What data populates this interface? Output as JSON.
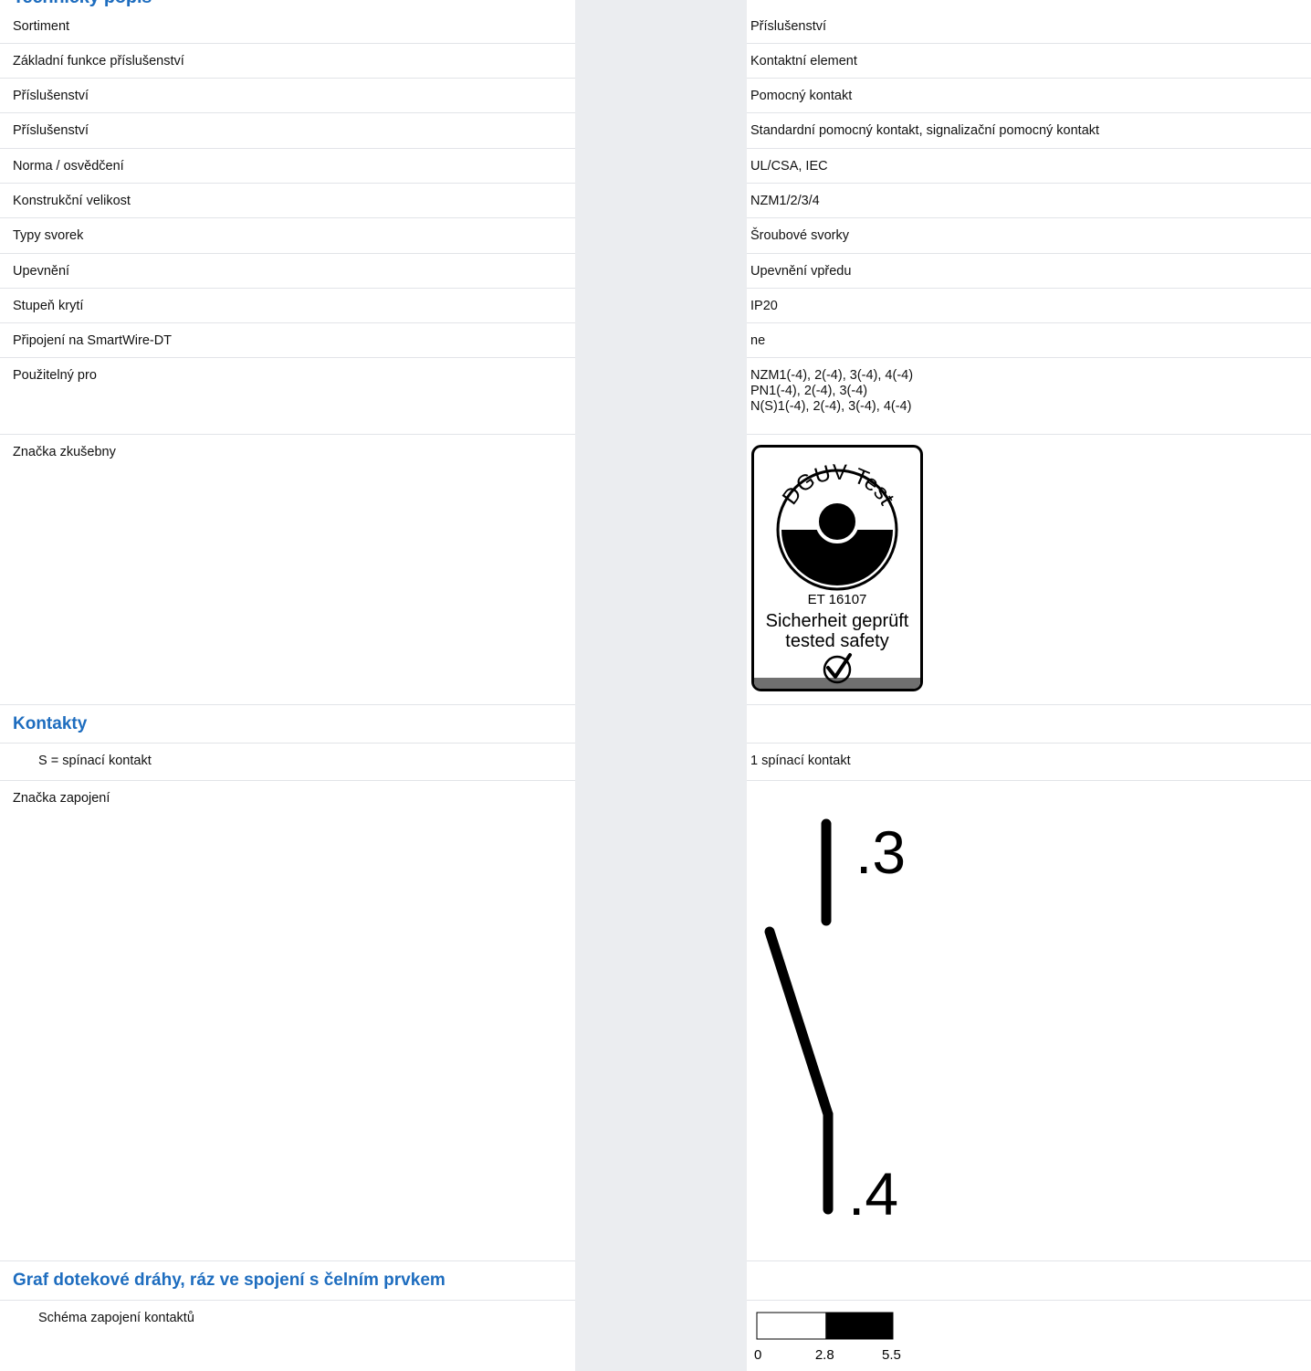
{
  "header": {
    "title": "Technický popis"
  },
  "properties": [
    {
      "label": "Sortiment",
      "value": "Příslušenství"
    },
    {
      "label": "Základní funkce příslušenství",
      "value": "Kontaktní element"
    },
    {
      "label": "Příslušenství",
      "value": "Pomocný kontakt"
    },
    {
      "label": "Příslušenství",
      "value": "Standardní pomocný kontakt, signalizační pomocný kontakt"
    },
    {
      "label": "Norma / osvědčení",
      "value": "UL/CSA, IEC"
    },
    {
      "label": "Konstrukční velikost",
      "value": "NZM1/2/3/4"
    },
    {
      "label": "Typy svorek",
      "value": "Šroubové svorky"
    },
    {
      "label": "Upevnění",
      "value": "Upevnění vpředu"
    },
    {
      "label": "Stupeň krytí",
      "value": "IP20"
    },
    {
      "label": "Připojení na SmartWire-DT",
      "value": "ne"
    }
  ],
  "usable_for": {
    "label": "Použitelný pro",
    "lines": [
      "NZM1(-4), 2(-4), 3(-4), 4(-4)",
      "PN1(-4), 2(-4), 3(-4)",
      "N(S)1(-4), 2(-4), 3(-4), 4(-4)"
    ]
  },
  "test_mark": {
    "label": "Značka zkušebny",
    "badge_ring_text": "DGUV Test",
    "badge_id": "ET 16107",
    "badge_line1": "Sicherheit geprüft",
    "badge_line2": "tested safety"
  },
  "contacts": {
    "title": "Kontakty",
    "no_label": "S = spínací kontakt",
    "no_value": "1 spínací kontakt",
    "wiring_label": "Značka zapojení",
    "terminal_top": ".3",
    "terminal_bottom": ".4"
  },
  "travel": {
    "title": "Graf dotekové dráhy, ráz ve spojení s čelním prvkem",
    "label": "Schéma zapojení kontaktů"
  },
  "chart_data": {
    "type": "bar",
    "segments": [
      {
        "from": 0,
        "to": 2.8,
        "state": "open",
        "color": "#ffffff"
      },
      {
        "from": 2.8,
        "to": 5.5,
        "state": "closed",
        "color": "#000000"
      }
    ],
    "tick_labels": [
      "0",
      "2.8",
      "5.5"
    ],
    "xlim": [
      0,
      5.5
    ]
  }
}
